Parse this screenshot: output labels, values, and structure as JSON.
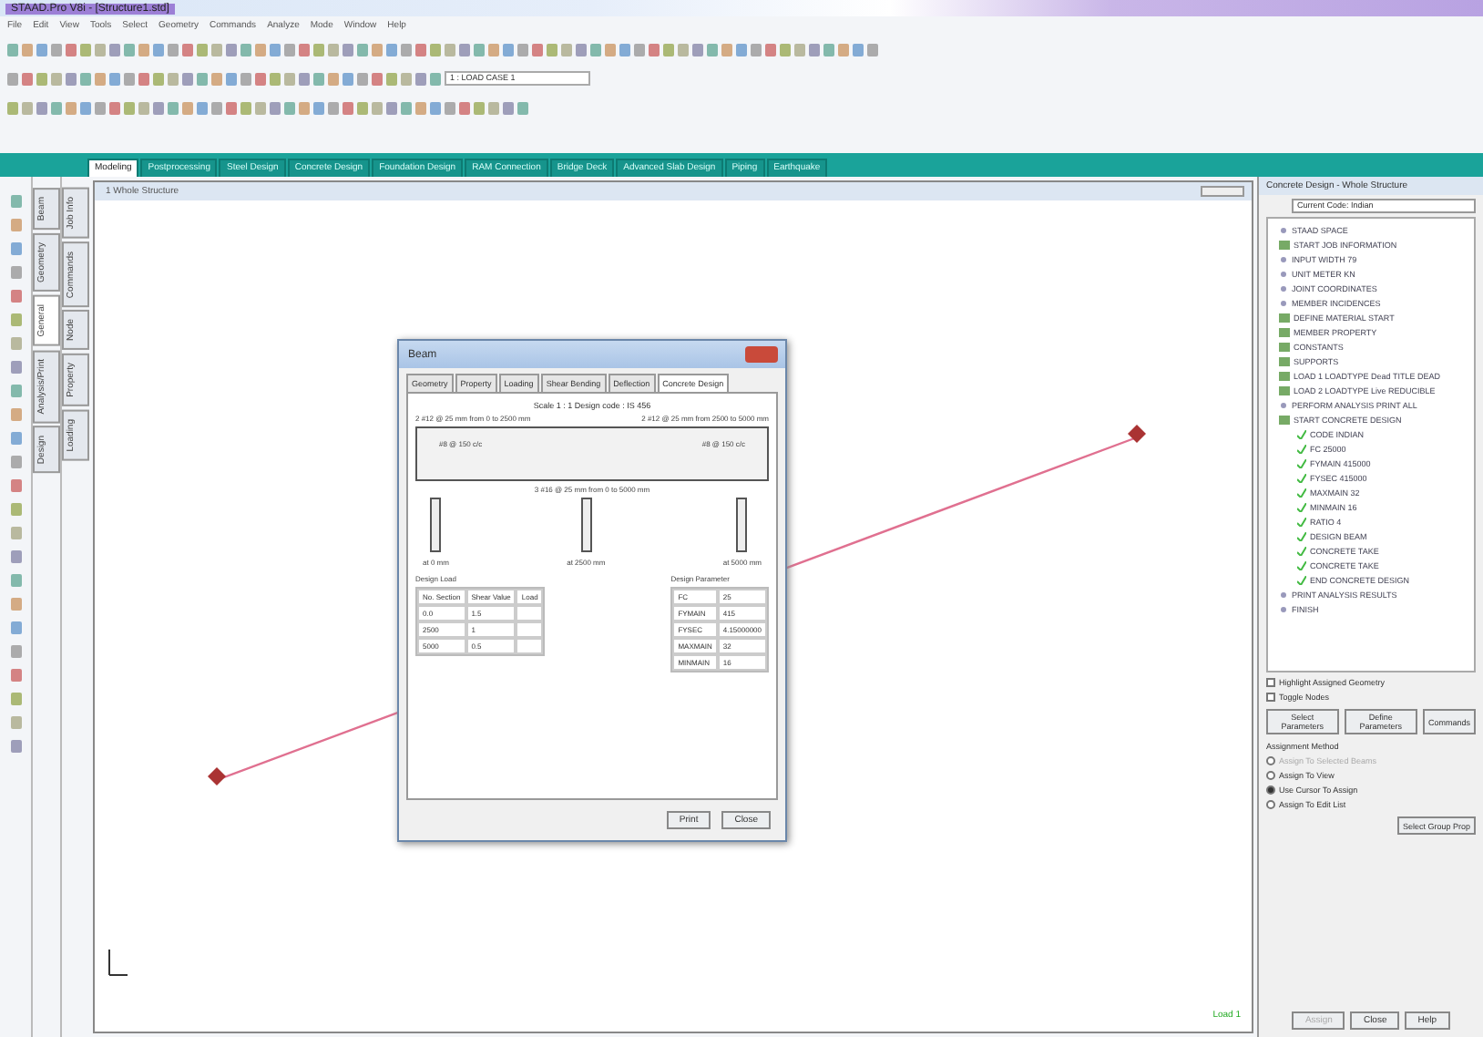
{
  "window": {
    "title": "STAAD.Pro V8i - [Structure1.std]"
  },
  "menu": [
    "File",
    "Edit",
    "View",
    "Tools",
    "Select",
    "Geometry",
    "Commands",
    "Analyze",
    "Mode",
    "Window",
    "Help"
  ],
  "load_combo": {
    "value": "1 : LOAD CASE 1"
  },
  "tabs": [
    {
      "label": "Modeling",
      "selected": true
    },
    {
      "label": "Postprocessing",
      "selected": false
    },
    {
      "label": "Steel Design",
      "selected": false
    },
    {
      "label": "Concrete Design",
      "selected": false
    },
    {
      "label": "Foundation Design",
      "selected": false
    },
    {
      "label": "RAM Connection",
      "selected": false
    },
    {
      "label": "Bridge Deck",
      "selected": false
    },
    {
      "label": "Advanced Slab Design",
      "selected": false
    },
    {
      "label": "Piping",
      "selected": false
    },
    {
      "label": "Earthquake",
      "selected": false
    }
  ],
  "side_tabs": [
    {
      "label": "Beam",
      "selected": false
    },
    {
      "label": "Geometry",
      "selected": false
    },
    {
      "label": "General",
      "selected": true
    },
    {
      "label": "Analysis/Print",
      "selected": false
    },
    {
      "label": "Design",
      "selected": false
    }
  ],
  "side_tabs_2": [
    {
      "label": "Job Info",
      "selected": false
    },
    {
      "label": "Commands",
      "selected": false
    },
    {
      "label": "Node",
      "selected": false
    },
    {
      "label": "Property",
      "selected": false
    },
    {
      "label": "Loading",
      "selected": false
    }
  ],
  "view": {
    "title": "1 Whole Structure",
    "status": "Load 1"
  },
  "dialog": {
    "title": "Beam",
    "tabs": [
      {
        "label": "Geometry",
        "selected": false
      },
      {
        "label": "Property",
        "selected": false
      },
      {
        "label": "Loading",
        "selected": false
      },
      {
        "label": "Shear Bending",
        "selected": false
      },
      {
        "label": "Deflection",
        "selected": false
      },
      {
        "label": "Concrete Design",
        "selected": true
      }
    ],
    "caption": "Scale 1 : 1  Design code : IS 456",
    "top_left": "2 #12 @ 25 mm from 0 to 2500 mm",
    "top_right": "2 #12 @ 25 mm from 2500 to 5000 mm",
    "stirrup_left": "#8 @ 150 c/c",
    "stirrup_right": "#8 @ 150 c/c",
    "bottom": "3 #16 @ 25 mm from 0 to 5000 mm",
    "sections": [
      "at 0 mm",
      "at 2500 mm",
      "at 5000 mm"
    ],
    "load_title": "Design Load",
    "load_columns": [
      "No. Section",
      "Shear Value",
      "Load"
    ],
    "load_rows": [
      [
        "0.0",
        "1.5",
        ""
      ],
      [
        "2500",
        "1",
        ""
      ],
      [
        "5000",
        "0.5",
        ""
      ]
    ],
    "param_title": "Design Parameter",
    "params": [
      [
        "FC",
        "25"
      ],
      [
        "FYMAIN",
        "415"
      ],
      [
        "FYSEC",
        "4.15000000"
      ],
      [
        "MAXMAIN",
        "32"
      ],
      [
        "MINMAIN",
        "16"
      ]
    ],
    "buttons": [
      "Print",
      "Close"
    ]
  },
  "panel": {
    "title": "Concrete Design - Whole Structure",
    "code": "Current Code: Indian",
    "tree": [
      {
        "label": "STAAD SPACE",
        "kind": "leaf"
      },
      {
        "label": "START JOB INFORMATION",
        "kind": "folder"
      },
      {
        "label": "INPUT WIDTH 79",
        "kind": "leaf"
      },
      {
        "label": "UNIT METER KN",
        "kind": "leaf"
      },
      {
        "label": "JOINT COORDINATES",
        "kind": "leaf"
      },
      {
        "label": "MEMBER INCIDENCES",
        "kind": "leaf"
      },
      {
        "label": "DEFINE MATERIAL START",
        "kind": "folder"
      },
      {
        "label": "MEMBER PROPERTY",
        "kind": "folder"
      },
      {
        "label": "CONSTANTS",
        "kind": "folder"
      },
      {
        "label": "SUPPORTS",
        "kind": "folder"
      },
      {
        "label": "LOAD 1 LOADTYPE Dead TITLE DEAD",
        "kind": "folder"
      },
      {
        "label": "LOAD 2 LOADTYPE Live REDUCIBLE",
        "kind": "folder"
      },
      {
        "label": "PERFORM ANALYSIS PRINT ALL",
        "kind": "leaf"
      },
      {
        "label": "START CONCRETE DESIGN",
        "kind": "folder"
      },
      {
        "label": "CODE INDIAN",
        "kind": "check"
      },
      {
        "label": "FC 25000",
        "kind": "check"
      },
      {
        "label": "FYMAIN 415000",
        "kind": "check"
      },
      {
        "label": "FYSEC 415000",
        "kind": "check"
      },
      {
        "label": "MAXMAIN 32",
        "kind": "check"
      },
      {
        "label": "MINMAIN 16",
        "kind": "check"
      },
      {
        "label": "RATIO 4",
        "kind": "check"
      },
      {
        "label": "DESIGN BEAM",
        "kind": "check"
      },
      {
        "label": "CONCRETE TAKE",
        "kind": "check"
      },
      {
        "label": "CONCRETE TAKE",
        "kind": "check"
      },
      {
        "label": "END CONCRETE DESIGN",
        "kind": "check"
      },
      {
        "label": "PRINT ANALYSIS RESULTS",
        "kind": "leaf"
      },
      {
        "label": "FINISH",
        "kind": "leaf"
      }
    ],
    "checks": [
      {
        "label": "Highlight Assigned Geometry",
        "checked": false
      },
      {
        "label": "Toggle Nodes",
        "checked": false
      }
    ],
    "actions": [
      "Select Parameters",
      "Define Parameters",
      "Commands"
    ],
    "method_title": "Assignment Method",
    "methods": [
      {
        "label": "Assign To Selected Beams",
        "selected": false,
        "disabled": true
      },
      {
        "label": "Assign To View",
        "selected": false,
        "disabled": false
      },
      {
        "label": "Use Cursor To Assign",
        "selected": true,
        "disabled": false
      },
      {
        "label": "Assign To Edit List",
        "selected": false,
        "disabled": false
      }
    ],
    "select_group": "Select Group Prop",
    "bottom": [
      {
        "label": "Assign",
        "disabled": true
      },
      {
        "label": "Close",
        "disabled": false
      },
      {
        "label": "Help",
        "disabled": false
      }
    ]
  }
}
